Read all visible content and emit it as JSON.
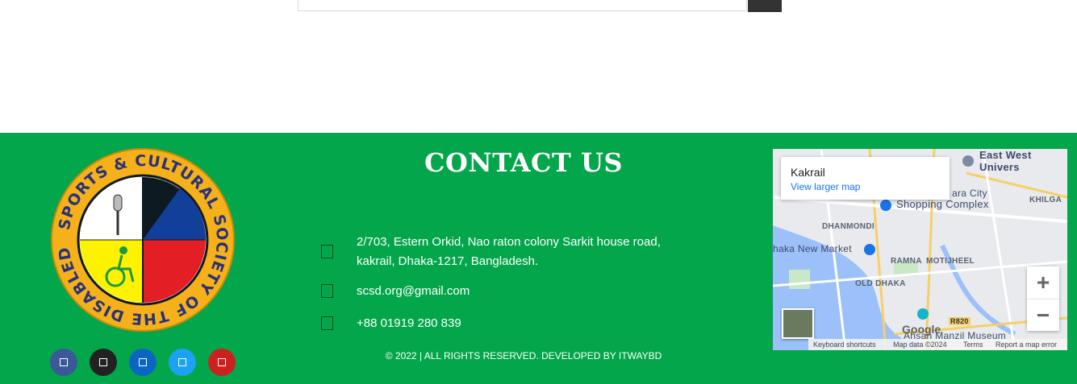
{
  "contact": {
    "title": "CONTACT US",
    "address_line1": "2/703, Estern Orkid, Nao raton colony Sarkit house road,",
    "address_line2": "kakrail, Dhaka-1217, Bangladesh.",
    "email": "scsd.org@gmail.com",
    "phone": "+88 01919 280 839",
    "copyright": "© 2022 | ALL RIGHTS RESERVED. DEVELOPED BY ITWAYBD"
  },
  "logo": {
    "ring_text": "SPORTS & CULTURAL SOCIETY OF THE DISABLED"
  },
  "social": [
    {
      "icon": "facebook-icon",
      "color": "#3b5998"
    },
    {
      "icon": "tiktok-icon",
      "color": "#222222"
    },
    {
      "icon": "linkedin-icon",
      "color": "#0a66c2"
    },
    {
      "icon": "twitter-icon",
      "color": "#1da1f2"
    },
    {
      "icon": "youtube-icon",
      "color": "#cd201f"
    }
  ],
  "map": {
    "place_name": "Kakrail",
    "view_larger": "View larger map",
    "labels": {
      "dhanmondi": "DHANMONDI",
      "new_market": "haka New Market",
      "ramna": "RAMNA",
      "motijheel": "MOTIJHEEL",
      "old_dhaka": "OLD DHAKA",
      "shopping": "Shopping Complex",
      "east_west": "East West Univers",
      "khilga": "KHILGA",
      "ahsan": "Ahsan Manzil Museum",
      "road": "R820",
      "city": "ara City"
    },
    "google": "Google",
    "keyboard": "Keyboard shortcuts",
    "map_data": "Map data ©2024",
    "terms": "Terms",
    "report": "Report a map error",
    "zoom_in": "+",
    "zoom_out": "−"
  },
  "colors": {
    "footer_bg": "#03a64a",
    "logo_yellow": "#f6b11a",
    "logo_blue": "#123f99",
    "logo_red": "#e31e24",
    "logo_dark": "#0e1a22"
  }
}
